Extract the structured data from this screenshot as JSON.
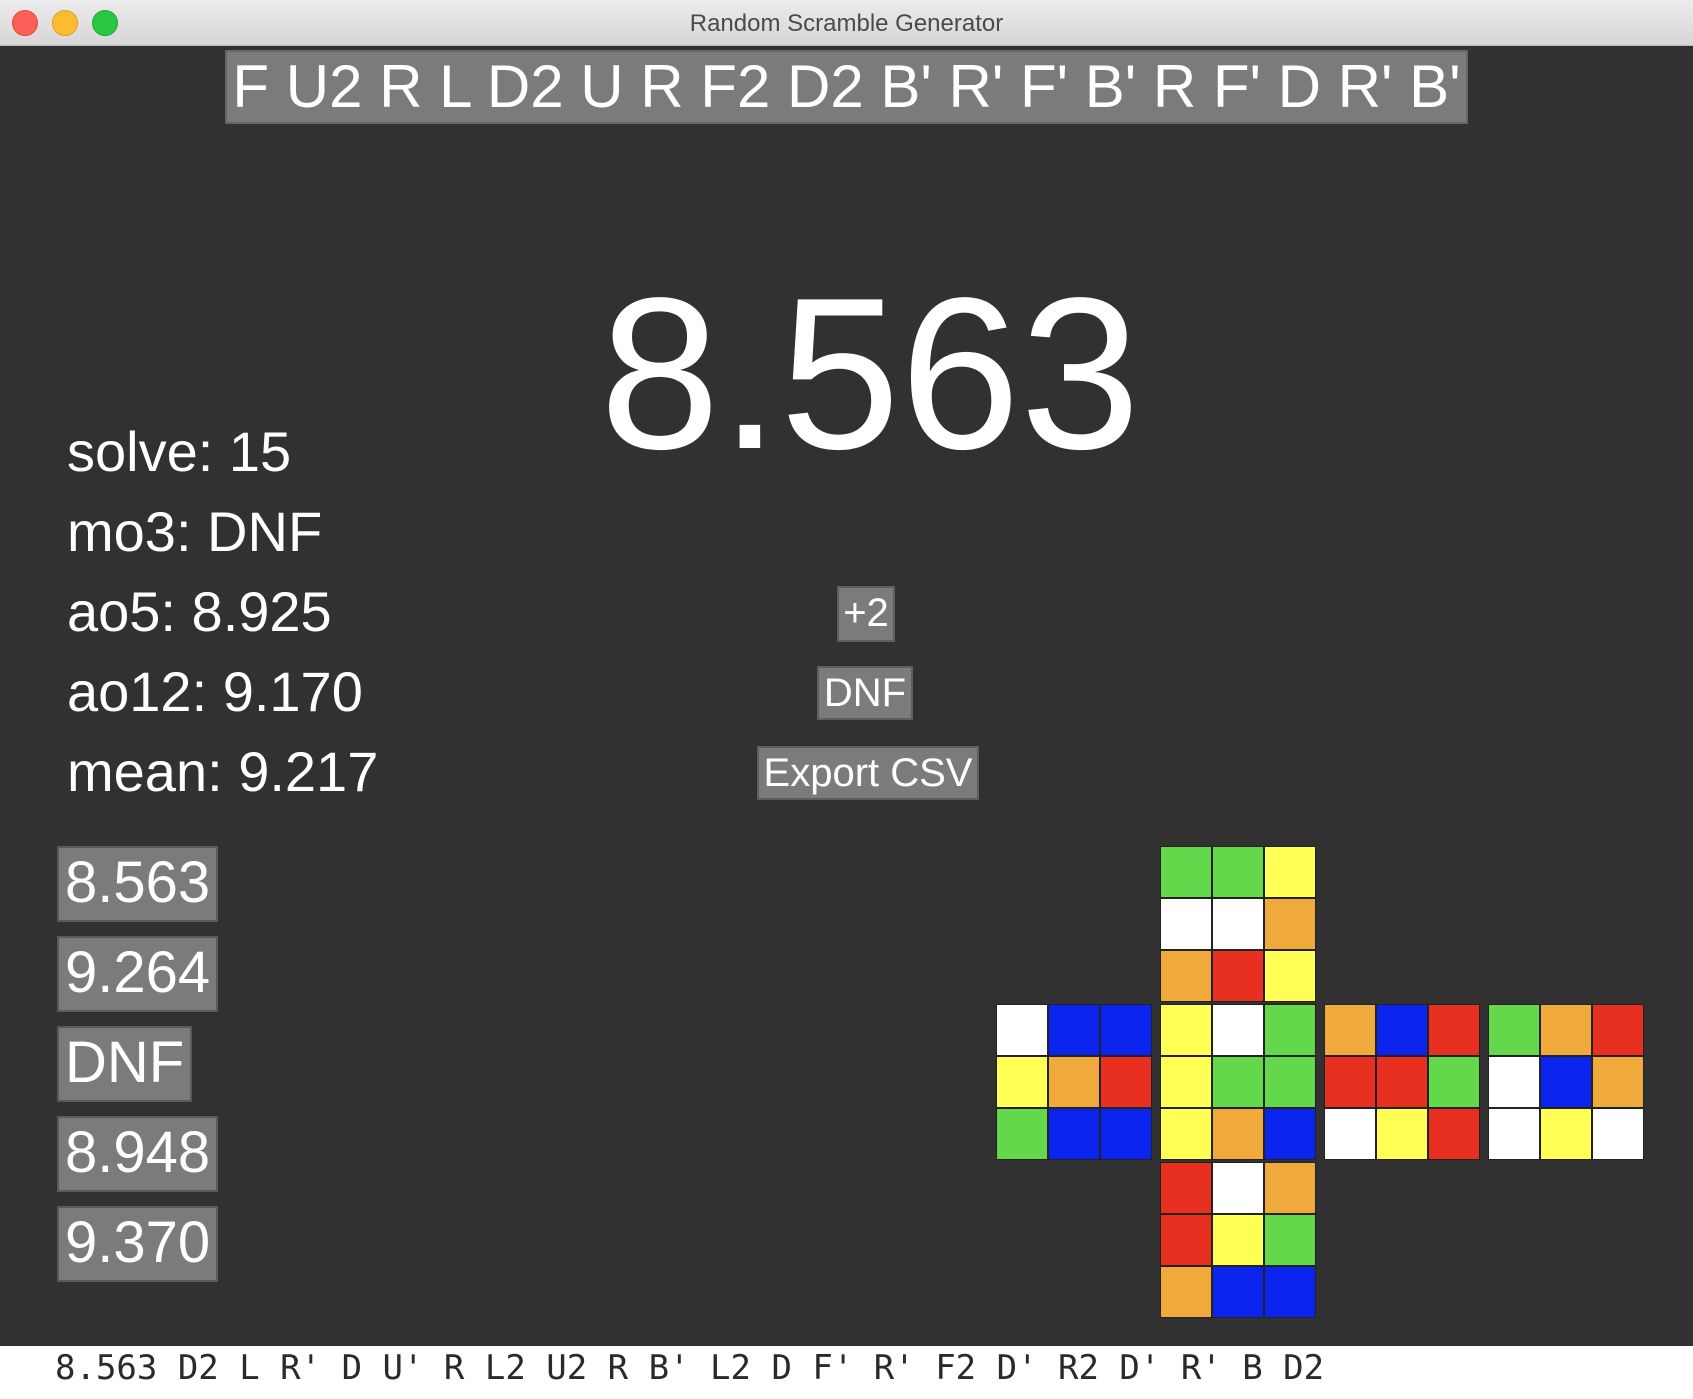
{
  "window": {
    "title": "Random Scramble Generator"
  },
  "scramble": "F U2 R L D2 U R F2 D2 B' R' F' B' R F' D R' B'",
  "timer": "8.563",
  "stats": [
    {
      "label": "solve: 15"
    },
    {
      "label": "mo3: DNF"
    },
    {
      "label": "ao5: 8.925"
    },
    {
      "label": "ao12: 9.170"
    },
    {
      "label": "mean: 9.217"
    }
  ],
  "buttons": {
    "plus2": "+2",
    "dnf": "DNF",
    "export": "Export CSV"
  },
  "history": [
    "8.563",
    "9.264",
    "DNF",
    "8.948",
    "9.370"
  ],
  "colors": {
    "G": "#62d84a",
    "Y": "#ffff55",
    "W": "#ffffff",
    "O": "#f0aa3c",
    "R": "#e83020",
    "B": "#0a24ee"
  },
  "cube": {
    "up": [
      "G",
      "G",
      "Y",
      "W",
      "W",
      "O",
      "O",
      "R",
      "Y"
    ],
    "left": [
      "W",
      "B",
      "B",
      "Y",
      "O",
      "R",
      "G",
      "B",
      "B"
    ],
    "front": [
      "Y",
      "W",
      "G",
      "Y",
      "G",
      "G",
      "Y",
      "O",
      "B"
    ],
    "right": [
      "O",
      "B",
      "R",
      "R",
      "R",
      "G",
      "W",
      "Y",
      "R"
    ],
    "back": [
      "G",
      "O",
      "R",
      "W",
      "B",
      "O",
      "W",
      "Y",
      "W"
    ],
    "down": [
      "R",
      "W",
      "O",
      "R",
      "Y",
      "G",
      "O",
      "B",
      "B"
    ]
  },
  "status_line": "8.563 D2 L R' D U' R L2 U2 R B' L2 D F' R' F2 D' R2 D' R' B D2"
}
